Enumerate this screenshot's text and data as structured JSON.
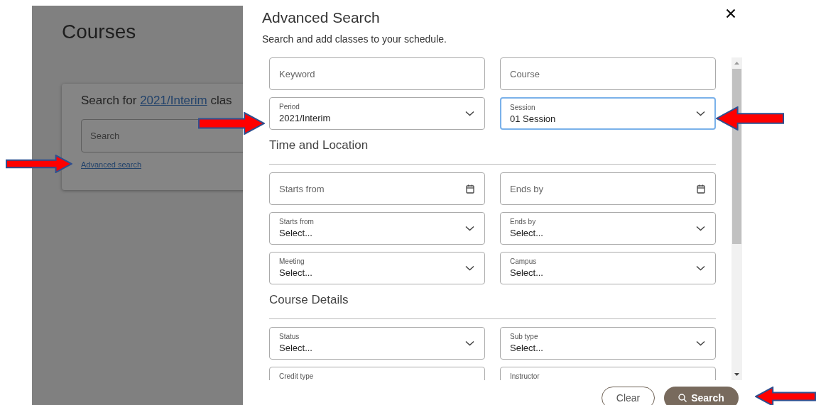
{
  "background_page": {
    "title": "Courses",
    "card": {
      "prompt_prefix": "Search for ",
      "period_link": "2021/Interim",
      "prompt_suffix": " clas",
      "search": {
        "placeholder": "Search"
      },
      "advanced_link": "Advanced search"
    }
  },
  "dialog": {
    "title": "Advanced Search",
    "subtitle": "Search and add classes to your schedule.",
    "sections": [
      {
        "fields": [
          {
            "kind": "text",
            "placeholder": "Keyword"
          },
          {
            "kind": "text",
            "placeholder": "Course"
          },
          {
            "kind": "select",
            "label": "Period",
            "value": "2021/Interim",
            "focused": false
          },
          {
            "kind": "select",
            "label": "Session",
            "value": "01 Session",
            "focused": true
          }
        ]
      },
      {
        "heading": "Time and Location",
        "fields": [
          {
            "kind": "date",
            "placeholder": "Starts from"
          },
          {
            "kind": "date",
            "placeholder": "Ends by"
          },
          {
            "kind": "select",
            "label": "Starts from",
            "value": "Select...",
            "focused": false
          },
          {
            "kind": "select",
            "label": "Ends by",
            "value": "Select...",
            "focused": false
          },
          {
            "kind": "select",
            "label": "Meeting",
            "value": "Select...",
            "focused": false
          },
          {
            "kind": "select",
            "label": "Campus",
            "value": "Select...",
            "focused": false
          }
        ]
      },
      {
        "heading": "Course Details",
        "fields": [
          {
            "kind": "select",
            "label": "Status",
            "value": "Select...",
            "focused": false
          },
          {
            "kind": "select",
            "label": "Sub type",
            "value": "Select...",
            "focused": false
          },
          {
            "kind": "select",
            "label": "Credit type",
            "focused": false
          },
          {
            "kind": "select",
            "label": "Instructor",
            "focused": false
          }
        ]
      }
    ],
    "buttons": [
      {
        "label": "Clear",
        "kind": "secondary"
      },
      {
        "label": "Search",
        "kind": "primary"
      }
    ]
  },
  "annotations": [
    {
      "kind": "arrow",
      "points_left": false
    },
    {
      "kind": "arrow",
      "points_left": false
    },
    {
      "kind": "arrow",
      "points_left": true
    },
    {
      "kind": "arrow",
      "points_left": true
    }
  ]
}
